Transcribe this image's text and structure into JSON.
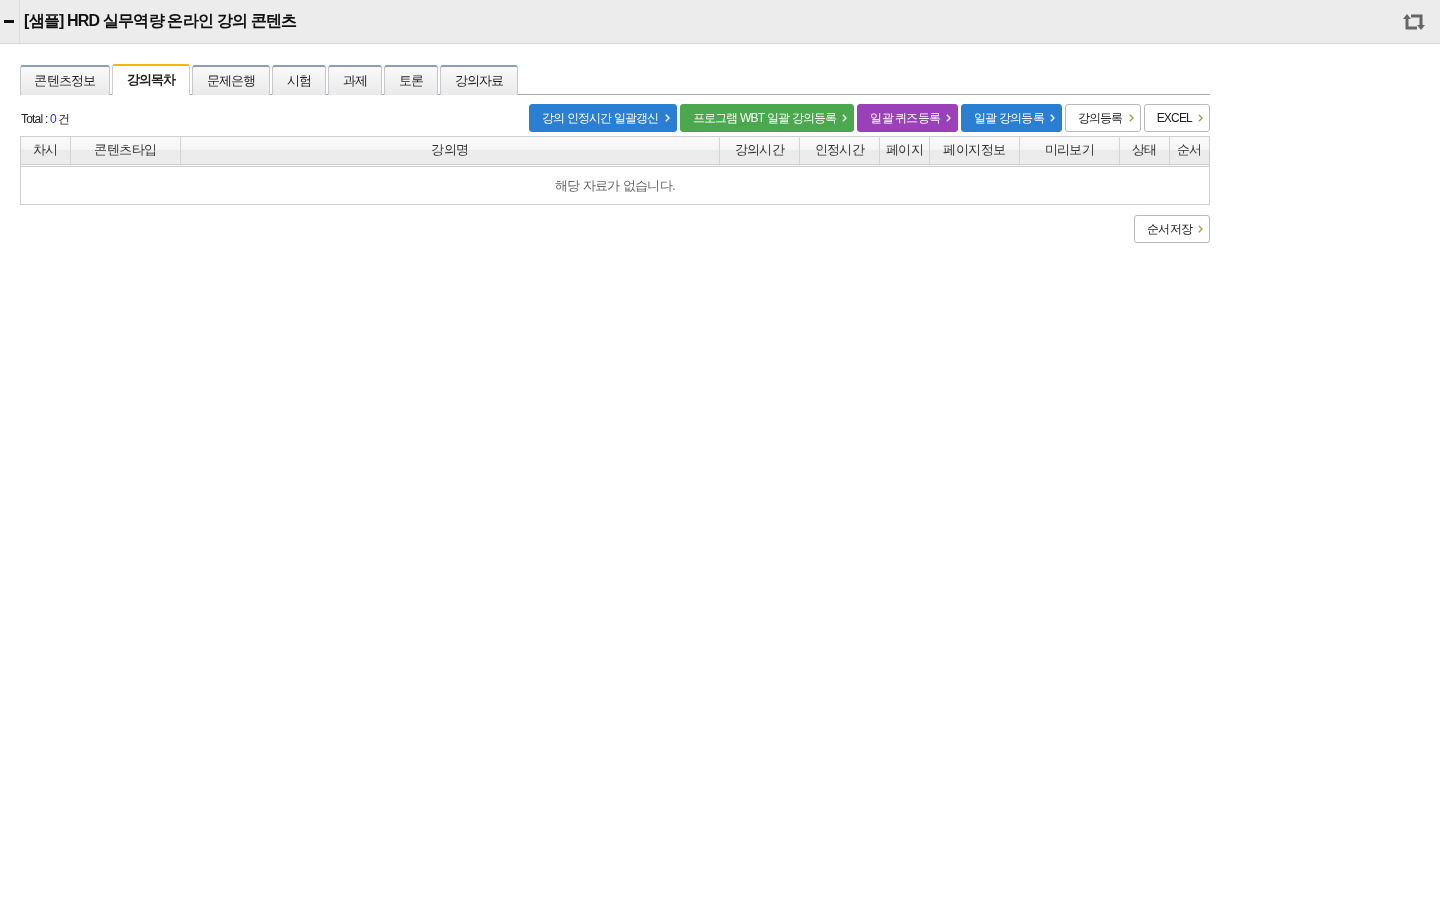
{
  "header": {
    "title": "[샘플] HRD 실무역량 온라인 강의 콘텐츠"
  },
  "tabs": [
    {
      "label": "콘텐츠정보",
      "selected": false
    },
    {
      "label": "강의목차",
      "selected": true
    },
    {
      "label": "문제은행",
      "selected": false
    },
    {
      "label": "시험",
      "selected": false
    },
    {
      "label": "과제",
      "selected": false
    },
    {
      "label": "토론",
      "selected": false
    },
    {
      "label": "강의자료",
      "selected": false
    }
  ],
  "toolbar": {
    "total_label": "Total :",
    "total_count": "0",
    "total_unit": "건",
    "buttons": [
      {
        "label": "강의 인정시간 일괄갱신",
        "kind": "filled",
        "color": "#2a7fd2"
      },
      {
        "label": "프로그램 WBT 일괄 강의등록",
        "kind": "filled",
        "color": "#4ba84f"
      },
      {
        "label": "일괄 퀴즈등록",
        "kind": "filled",
        "color": "#9a40b8"
      },
      {
        "label": "일괄 강의등록",
        "kind": "filled",
        "color": "#2a7fd2"
      },
      {
        "label": "강의등록",
        "kind": "outline"
      },
      {
        "label": "EXCEL",
        "kind": "outline"
      }
    ]
  },
  "table": {
    "columns": [
      "차시",
      "콘텐츠타입",
      "강의명",
      "강의시간",
      "인정시간",
      "페이지",
      "페이지정보",
      "미리보기",
      "상태",
      "순서"
    ],
    "empty_message": "해당 자료가 없습니다."
  },
  "footer_buttons": [
    {
      "label": "순서저장",
      "kind": "outline"
    }
  ]
}
